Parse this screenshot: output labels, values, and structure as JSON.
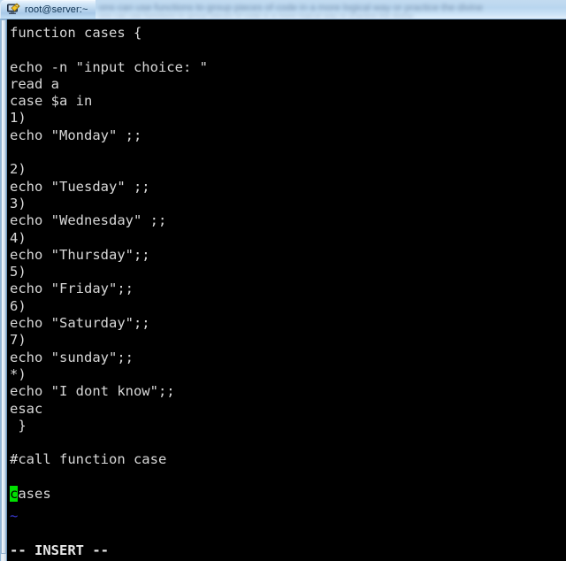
{
  "window": {
    "title": "root@server:~",
    "icon": "putty-terminal-icon"
  },
  "background": {
    "blurred_line_1": "ons can use functions to group pieces of code in a more logical way or practice the divine",
    "blurred_line_2": "ons can use functions to group pieces of code in a more logical way or practice the divine"
  },
  "terminal": {
    "lines": [
      "function cases {",
      "",
      "echo -n \"input choice: \"",
      "read a",
      "case $a in",
      "1)",
      "echo \"Monday\" ;;",
      "",
      "2)",
      "echo \"Tuesday\" ;;",
      "3)",
      "echo \"Wednesday\" ;;",
      "4)",
      "echo \"Thursday\";;",
      "5)",
      "echo \"Friday\";;",
      "6)",
      "echo \"Saturday\";;",
      "7)",
      "echo \"sunday\";;",
      "*)",
      "echo \"I dont know\";;",
      "esac",
      " }",
      "",
      "#call function case",
      ""
    ],
    "cursor_line": {
      "cursor_char": "c",
      "rest": "ases"
    },
    "empty_marker": "~",
    "status_line": "-- INSERT --",
    "colors": {
      "background": "#000000",
      "foreground": "#d8d8d8",
      "cursor": "#00e000",
      "tilde": "#3a3ad8"
    }
  }
}
